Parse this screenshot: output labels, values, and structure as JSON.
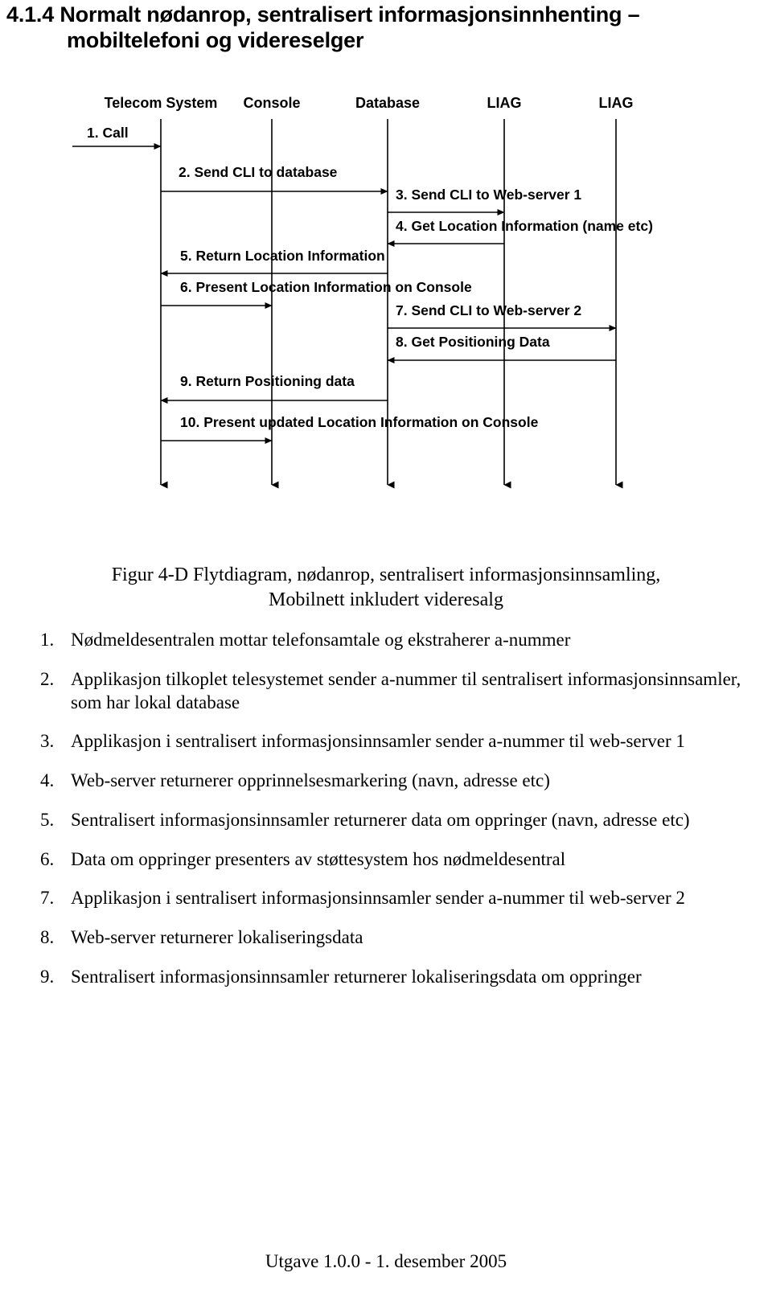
{
  "heading": {
    "number": "4.1.4",
    "line1": "Normalt nødanrop, sentralisert informasjonsinnhenting –",
    "line2": "mobiltelefoni og videreselger"
  },
  "diagram": {
    "lifelines": [
      {
        "label": "Telecom System"
      },
      {
        "label": "Console"
      },
      {
        "label": "Database"
      },
      {
        "label": "LIAG"
      },
      {
        "label": "LIAG"
      }
    ],
    "messages": [
      {
        "label": "1. Call",
        "from": -1,
        "to": 0,
        "direction": "right"
      },
      {
        "label": "2. Send CLI to database",
        "from": 0,
        "to": 2,
        "direction": "right"
      },
      {
        "label": "3. Send CLI to Web-server 1",
        "from": 2,
        "to": 3,
        "direction": "right"
      },
      {
        "label": "4. Get Location Information (name etc)",
        "from": 3,
        "to": 2,
        "direction": "left"
      },
      {
        "label": "5. Return Location Information",
        "from": 2,
        "to": 0,
        "direction": "left"
      },
      {
        "label": "6. Present Location Information on Console",
        "from": 0,
        "to": 1,
        "direction": "right"
      },
      {
        "label": "7. Send CLI to Web-server 2",
        "from": 2,
        "to": 4,
        "direction": "right"
      },
      {
        "label": "8. Get Positioning Data",
        "from": 4,
        "to": 2,
        "direction": "left"
      },
      {
        "label": "9. Return Positioning data",
        "from": 2,
        "to": 0,
        "direction": "left"
      },
      {
        "label": "10. Present updated Location Information on Console",
        "from": 0,
        "to": 1,
        "direction": "right"
      }
    ]
  },
  "caption": {
    "line1": "Figur 4-D Flytdiagram, nødanrop, sentralisert informasjonsinnsamling,",
    "line2": "Mobilnett inkludert videresalg"
  },
  "steps": [
    {
      "num": "1.",
      "text": "Nødmeldesentralen mottar telefonsamtale og ekstraherer a-nummer"
    },
    {
      "num": "2.",
      "text": "Applikasjon tilkoplet telesystemet sender a-nummer til sentralisert informasjonsinnsamler, som har lokal database"
    },
    {
      "num": "3.",
      "text": "Applikasjon i sentralisert informasjonsinnsamler sender a-nummer til web-server 1"
    },
    {
      "num": "4.",
      "text": "Web-server returnerer opprinnelsesmarkering (navn, adresse etc)"
    },
    {
      "num": "5.",
      "text": "Sentralisert informasjonsinnsamler returnerer data om oppringer (navn, adresse etc)"
    },
    {
      "num": "6.",
      "text": "Data om oppringer presenters av støttesystem hos nødmeldesentral"
    },
    {
      "num": "7.",
      "text": "Applikasjon i sentralisert informasjonsinnsamler sender a-nummer til web-server 2"
    },
    {
      "num": "8.",
      "text": "Web-server returnerer lokaliseringsdata"
    },
    {
      "num": "9.",
      "text": "Sentralisert informasjonsinnsamler returnerer lokaliseringsdata om oppringer"
    }
  ],
  "footer": {
    "text": "Utgave 1.0.0  -  1. desember 2005"
  }
}
